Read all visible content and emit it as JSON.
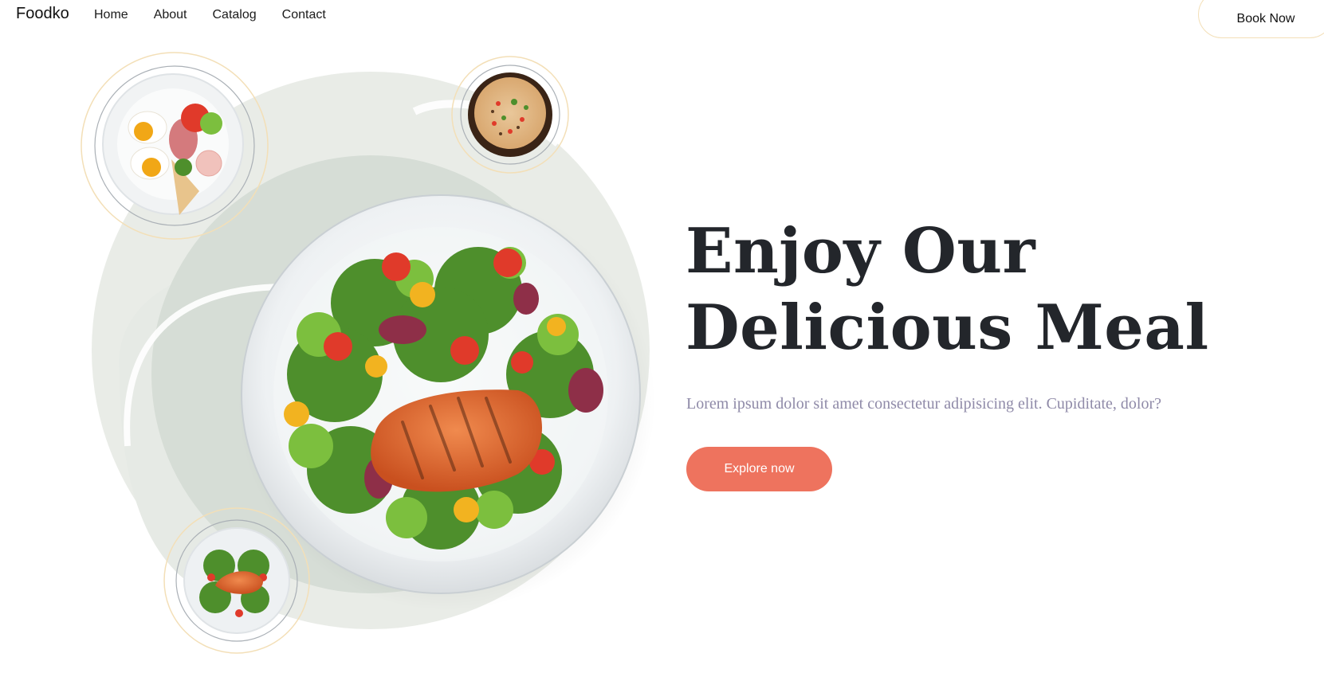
{
  "brand": {
    "name": "Foodko"
  },
  "nav": {
    "items": [
      "Home",
      "About",
      "Catalog",
      "Contact"
    ]
  },
  "header": {
    "cta_label": "Book Now"
  },
  "hero": {
    "title_line1": "Enjoy Our",
    "title_line2": "Delicious Meal",
    "subtitle": "Lorem ipsum dolor sit amet consectetur adipisicing elit. Cupiditate, dolor?",
    "cta_label": "Explore now"
  },
  "colors": {
    "accent": "#ee735e",
    "title": "#23262b",
    "subtitle": "#8f8aa8",
    "blob_light": "#e9ece7",
    "blob_dark": "#d6ddd6",
    "ring_gold": "#f3dfb7"
  },
  "images": {
    "main_plate": "salmon-salad-plate",
    "top_left": "breakfast-eggs-ham-plate",
    "top_right": "fried-rice-bowl",
    "bottom_left": "small-salmon-salad-plate"
  }
}
